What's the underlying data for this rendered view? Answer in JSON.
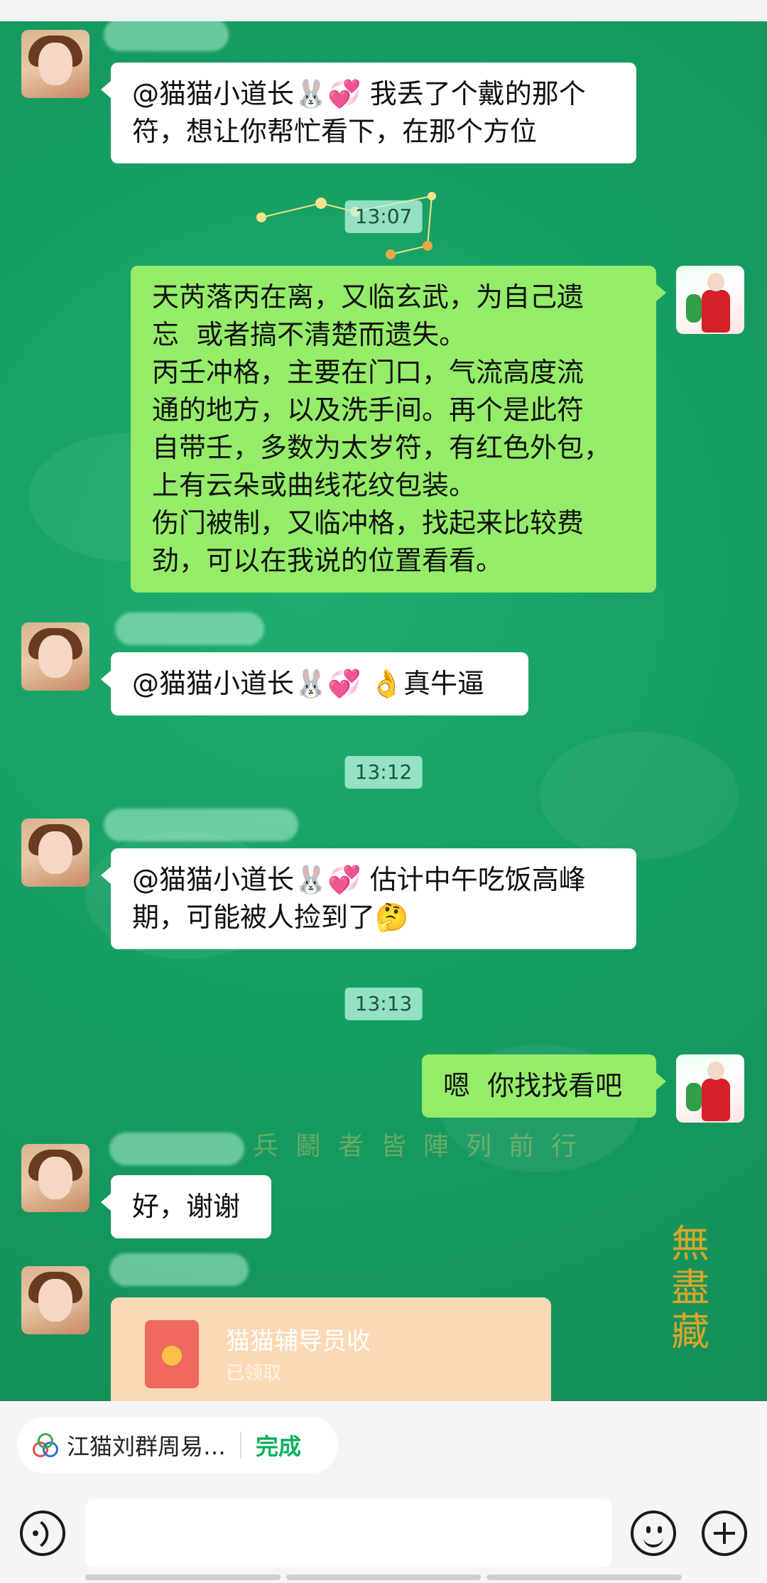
{
  "messages": [
    {
      "text": "@猫猫小道长🐰💞 我丢了个戴的那个\n符，想让你帮忙看下，在那个方位"
    },
    {
      "text": "天芮落丙在离，又临玄武，为自己遗\n忘  或者搞不清楚而遗失。\n丙壬冲格，主要在门口，气流高度流\n通的地方，以及洗手间。再个是此符\n自带壬，多数为太岁符，有红色外包，\n上有云朵或曲线花纹包装。\n伤门被制，又临冲格，找起来比较费\n劲，可以在我说的位置看看。"
    },
    {
      "text": "@猫猫小道长🐰💞 👌真牛逼"
    },
    {
      "text": "@猫猫小道长🐰💞 估计中午吃饭高峰\n期，可能被人捡到了🤔"
    },
    {
      "text": "嗯  你找找看吧"
    },
    {
      "text": "好，谢谢"
    }
  ],
  "times": [
    "13:07",
    "13:12",
    "13:13"
  ],
  "red_packet": {
    "title": "猫猫辅导员收",
    "status": "已领取"
  },
  "background_text": {
    "faint": "兵鬭者皆陣列前行",
    "gold": "無盡藏"
  },
  "bottom_bar": {
    "note_title": "江猫刘群周易…",
    "done_label": "完成"
  },
  "colors": {
    "chat_bg": "#169f63",
    "self_bubble": "#95ec69",
    "other_bubble": "#ffffff",
    "accent_green": "#07b15c"
  }
}
